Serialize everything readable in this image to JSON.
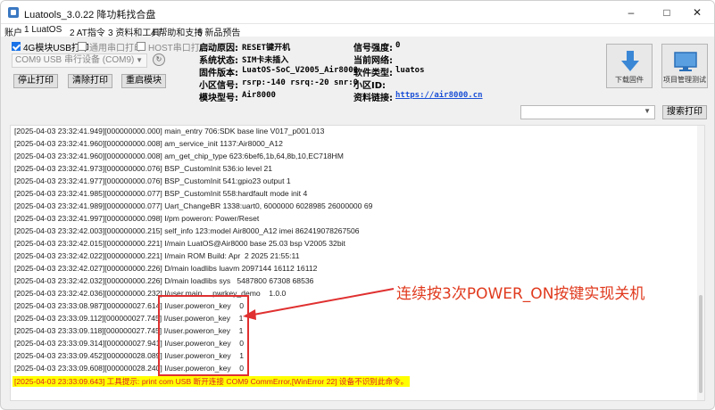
{
  "window": {
    "title": "Luatools_3.0.22 降功耗找合盘",
    "controls": [
      "minimize-icon",
      "maximize-icon",
      "close-icon"
    ]
  },
  "menu": [
    {
      "label": "账户"
    },
    {
      "label": "1 LuatOS"
    },
    {
      "label": "2 AT指令"
    },
    {
      "label": "3 资料和工具"
    },
    {
      "label": "4 帮助和支持"
    },
    {
      "label": "5 新品预告"
    }
  ],
  "options": {
    "usb4g": {
      "label": "4G模块USB打印",
      "checked": true
    },
    "generic_serial": {
      "label": "通用串口打印",
      "checked": false
    },
    "host_serial": {
      "label": "HOST串口打印",
      "checked": false
    }
  },
  "port": {
    "value": "COM9 USB 串行设备 (COM9)"
  },
  "buttons": {
    "stop_print": "停止打印",
    "clear_print": "清除打印",
    "reset_module": "重启模块",
    "download_firmware": "下载固件",
    "project_manage": "项目管理测试",
    "search_print": "搜索打印"
  },
  "device_info": {
    "boot_reason": {
      "label": "启动原因:",
      "value": "RESET键开机"
    },
    "system_status": {
      "label": "系统状态:",
      "value": "SIM卡未插入"
    },
    "firmware_version": {
      "label": "固件版本:",
      "value": "LuatOS-SoC_V2005_Air8000"
    },
    "cell_signal": {
      "label": "小区信号:",
      "value": "rsrp:-140 rsrq:-20 snr:0"
    },
    "module_model": {
      "label": "模块型号:",
      "value": "Air8000"
    },
    "signal_strength": {
      "label": "信号强度:",
      "value": "0"
    },
    "current_network": {
      "label": "当前网络:",
      "value": ""
    },
    "cell_id": {
      "label": "小区ID:",
      "value": ""
    },
    "software_type": {
      "label": "软件类型:",
      "value": "luatos"
    },
    "resource_link": {
      "label": "资料链接:",
      "value": "https://air8000.cn"
    }
  },
  "log": [
    "[2025-04-03 23:32:41.949][000000000.000] main_entry 706:SDK base line V017_p001.013",
    "[2025-04-03 23:32:41.960][000000000.008] am_service_init 1137:Air8000_A12",
    "[2025-04-03 23:32:41.960][000000000.008] am_get_chip_type 623:6bef6,1b,64,8b,10,EC718HM",
    "[2025-04-03 23:32:41.973][000000000.076] BSP_CustomInit 536:io level 21",
    "[2025-04-03 23:32:41.977][000000000.076] BSP_CustomInit 541:gpio23 output 1",
    "[2025-04-03 23:32:41.985][000000000.077] BSP_CustomInit 558:hardfault mode init 4",
    "[2025-04-03 23:32:41.989][000000000.077] Uart_ChangeBR 1338:uart0, 6000000 6028985 26000000 69",
    "[2025-04-03 23:32:41.997][000000000.098] I/pm poweron: Power/Reset",
    "[2025-04-03 23:32:42.003][000000000.215] self_info 123:model Air8000_A12 imei 862419078267506",
    "[2025-04-03 23:32:42.015][000000000.221] I/main LuatOS@Air8000 base 25.03 bsp V2005 32bit",
    "[2025-04-03 23:32:42.022][000000000.221] I/main ROM Build: Apr  2 2025 21:55:11",
    "[2025-04-03 23:32:42.027][000000000.226] D/main loadlibs luavm 2097144 16112 16112",
    "[2025-04-03 23:32:42.032][000000000.226] D/main loadlibs sys   5487800 67308 68536",
    "[2025-04-03 23:32:42.036][000000000.232] I/user.main     pwrkey_demo    1.0.0",
    "[2025-04-03 23:33:08.987][000000027.614] I/user.poweron_key    0",
    "[2025-04-03 23:33:09.112][000000027.745] I/user.poweron_key    1",
    "[2025-04-03 23:33:09.118][000000027.745] I/user.poweron_key    1",
    "[2025-04-03 23:33:09.314][000000027.941] I/user.poweron_key    0",
    "[2025-04-03 23:33:09.452][000000028.089] I/user.poweron_key    1",
    "[2025-04-03 23:33:09.608][000000028.240] I/user.poweron_key    0"
  ],
  "log_error": "[2025-04-03 23:33:09.643] 工具提示: print com USB 断开连接 COM9 CommError,[WinError 22] 设备不识别此命令。",
  "annotation": "连续按3次POWER_ON按键实现关机",
  "colors": {
    "annotation": "#e03a1e",
    "highlight_box": "#e03030",
    "error_bg": "#ffff00",
    "error_text": "#dd2222",
    "link": "#1a4fd6"
  }
}
